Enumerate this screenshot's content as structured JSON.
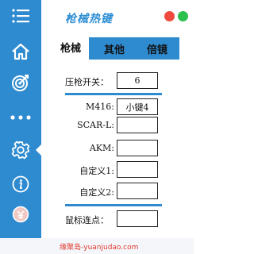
{
  "window": {
    "title": "枪械热键"
  },
  "sidebar": {
    "items": [
      {
        "icon": "menu-icon"
      },
      {
        "icon": "home-icon"
      },
      {
        "icon": "target-icon"
      },
      {
        "icon": "more-icon"
      },
      {
        "icon": "settings-icon"
      },
      {
        "icon": "info-icon"
      },
      {
        "icon": "coin-icon"
      }
    ]
  },
  "tabs": [
    {
      "label": "枪械"
    },
    {
      "label": "其他"
    },
    {
      "label": "倍镜"
    }
  ],
  "form": {
    "recoil_toggle_label": "压枪开关：",
    "recoil_toggle_value": "6",
    "m416_label": "M416:",
    "m416_value": "小键4",
    "scarl_label": "SCAR-L:",
    "scarl_value": "",
    "akm_label": "AKM:",
    "akm_value": "",
    "custom1_label": "自定义1:",
    "custom1_value": "",
    "custom2_label": "自定义2:",
    "custom2_value": "",
    "mouse_burst_label": "鼠标连点：",
    "mouse_burst_value": ""
  },
  "footer": {
    "text": "缘聚岛-yuanjudao.com"
  },
  "colors": {
    "accent": "#2e8bd0",
    "close": "#ee4b3e",
    "minimize": "#2bc04d",
    "footer_text": "#e23a30"
  }
}
